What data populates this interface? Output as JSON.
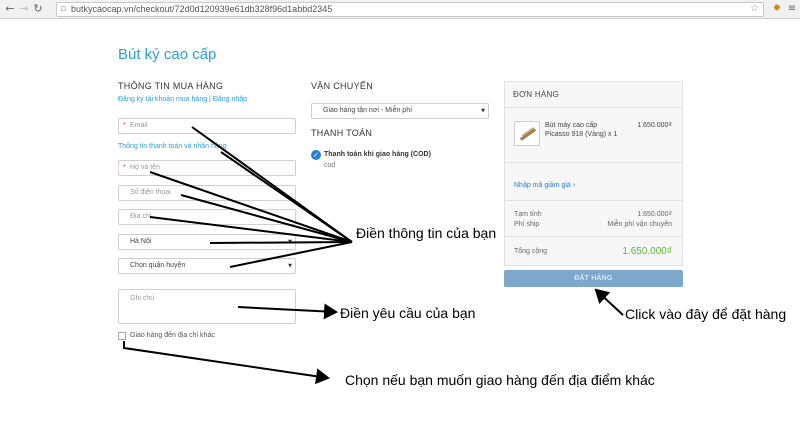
{
  "browser": {
    "url": "butkycaocap.vn/checkout/72d0d120939e61db328f96d1abbd2345"
  },
  "shop": {
    "title": "Bút ký cao cấp"
  },
  "customer": {
    "heading": "THÔNG TIN MUA HÀNG",
    "auth_link": "Đăng ký tài khoản mua hàng | Đăng nhập",
    "email_placeholder": "Email",
    "billing_link": "Thông tin thanh toán và nhận hàng",
    "name_placeholder": "Họ và tên",
    "phone_placeholder": "Số điện thoại",
    "address_placeholder": "Địa chỉ",
    "city_value": "Hà Nội",
    "district_value": "Chọn quận huyện",
    "note_placeholder": "Ghi chú",
    "other_address_label": "Giao hàng đến địa chỉ khác"
  },
  "shipping": {
    "heading": "VẬN CHUYỂN",
    "method": "Giao hàng tận nơi - Miễn phí"
  },
  "payment": {
    "heading": "THANH TOÁN",
    "method_title": "Thanh toán khi giao hàng (COD)",
    "method_sub": "cod"
  },
  "order": {
    "heading": "ĐƠN HÀNG",
    "product_name": "Bút máy cao cấp",
    "product_variant": "Picasso 918 (Vàng) x 1",
    "product_price": "1.650.000₫",
    "coupon_link": "Nhập mã giảm giá",
    "subtotal_label": "Tạm tính",
    "subtotal_value": "1.650.000₫",
    "shipping_label": "Phí ship",
    "shipping_value": "Miễn phí vận chuyển",
    "total_label": "Tổng cộng",
    "total_value": "1.650.000₫",
    "place_order_label": "ĐẶT HÀNG"
  },
  "annotations": {
    "fill_info": "Điền thông tin của bạn",
    "fill_request": "Điền yêu cầu của bạn",
    "click_order": "Click vào đây để đặt hàng",
    "other_address": "Chọn nếu bạn muốn giao hàng đến địa điểm khác"
  }
}
